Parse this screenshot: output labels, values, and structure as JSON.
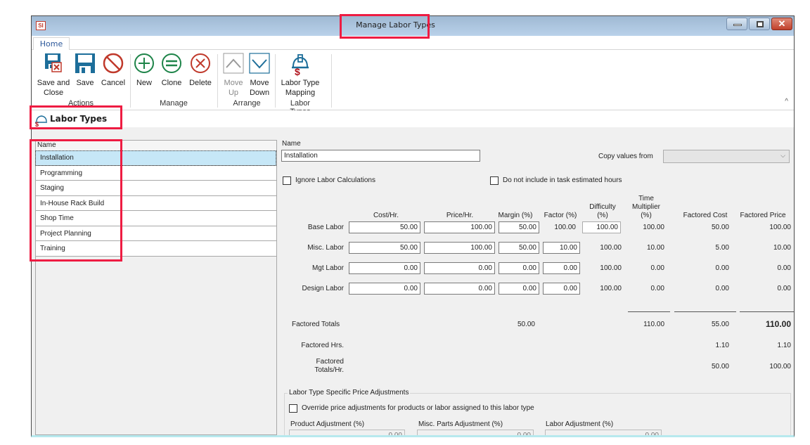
{
  "window": {
    "title": "Manage Labor Types",
    "app_icon": "SI",
    "controls": {
      "minimize": "minimize-icon",
      "maximize": "maximize-icon",
      "close": "close-icon"
    }
  },
  "ribbon": {
    "tabs": [
      {
        "label": "Home",
        "active": true
      }
    ],
    "groups": [
      {
        "label": "Actions",
        "buttons": [
          {
            "label_line1": "Save and",
            "label_line2": "Close",
            "icon": "save-close-icon",
            "enabled": true
          },
          {
            "label_line1": "Save",
            "label_line2": "",
            "icon": "save-icon",
            "enabled": true
          },
          {
            "label_line1": "Cancel",
            "label_line2": "",
            "icon": "cancel-icon",
            "enabled": true
          }
        ]
      },
      {
        "label": "Manage",
        "buttons": [
          {
            "label_line1": "New",
            "label_line2": "",
            "icon": "plus-circle-icon",
            "enabled": true
          },
          {
            "label_line1": "Clone",
            "label_line2": "",
            "icon": "equals-circle-icon",
            "enabled": true
          },
          {
            "label_line1": "Delete",
            "label_line2": "",
            "icon": "x-circle-icon",
            "enabled": true
          }
        ]
      },
      {
        "label": "Arrange",
        "buttons": [
          {
            "label_line1": "Move",
            "label_line2": "Up",
            "icon": "chevron-up-icon",
            "enabled": false
          },
          {
            "label_line1": "Move",
            "label_line2": "Down",
            "icon": "chevron-down-icon",
            "enabled": true
          }
        ]
      },
      {
        "label": "Labor Types",
        "buttons": [
          {
            "label_line1": "Labor Type",
            "label_line2": "Mapping",
            "icon": "hardhat-dollar-icon",
            "enabled": true
          }
        ]
      }
    ]
  },
  "section": {
    "title": "Labor Types",
    "icon": "hardhat-dollar-icon"
  },
  "list": {
    "header": "Name",
    "items": [
      "Installation",
      "Programming",
      "Staging",
      "In-House Rack Build",
      "Shop Time",
      "Project Planning",
      "Training"
    ],
    "selected_index": 0
  },
  "detail": {
    "name_label": "Name",
    "name_value": "Installation",
    "copy_from_label": "Copy values from",
    "copy_from_value": "",
    "ignore_calc_label": "Ignore Labor Calculations",
    "ignore_calc_checked": false,
    "exclude_hours_label": "Do not include in task estimated hours",
    "exclude_hours_checked": false,
    "columns": {
      "cost": "Cost/Hr.",
      "price": "Price/Hr.",
      "margin": "Margin (%)",
      "factor": "Factor (%)",
      "difficulty_1": "Difficulty",
      "difficulty_2": "(%)",
      "time_1": "Time",
      "time_2": "Multiplier",
      "time_3": "(%)",
      "factored_cost": "Factored Cost",
      "factored_price": "Factored Price"
    },
    "rows": [
      {
        "label": "Base Labor",
        "cost": "50.00",
        "price": "100.00",
        "margin": "50.00",
        "factor": "100.00",
        "difficulty": "100.00",
        "time_multiplier": "100.00",
        "factored_cost": "50.00",
        "factored_price": "100.00"
      },
      {
        "label": "Misc. Labor",
        "cost": "50.00",
        "price": "100.00",
        "margin": "50.00",
        "factor": "10.00",
        "difficulty": "100.00",
        "time_multiplier": "10.00",
        "factored_cost": "5.00",
        "factored_price": "10.00"
      },
      {
        "label": "Mgt Labor",
        "cost": "0.00",
        "price": "0.00",
        "margin": "0.00",
        "factor": "0.00",
        "difficulty": "100.00",
        "time_multiplier": "0.00",
        "factored_cost": "0.00",
        "factored_price": "0.00"
      },
      {
        "label": "Design Labor",
        "cost": "0.00",
        "price": "0.00",
        "margin": "0.00",
        "factor": "0.00",
        "difficulty": "100.00",
        "time_multiplier": "0.00",
        "factored_cost": "0.00",
        "factored_price": "0.00"
      }
    ],
    "totals": {
      "label": "Factored Totals",
      "margin": "50.00",
      "time_multiplier": "110.00",
      "factored_cost": "55.00",
      "factored_price": "110.00"
    },
    "hours": {
      "label": "Factored Hrs.",
      "factored_cost": "1.10",
      "factored_price": "1.10"
    },
    "per_hour": {
      "label_1": "Factored",
      "label_2": "Totals/Hr.",
      "factored_cost": "50.00",
      "factored_price": "100.00"
    },
    "adjustments": {
      "title": "Labor Type Specific Price Adjustments",
      "override_label": "Override price adjustments for products or labor assigned to this labor type",
      "override_checked": false,
      "product_label": "Product Adjustment (%)",
      "product_value": "0.00",
      "misc_label": "Misc. Parts Adjustment (%)",
      "misc_value": "0.00",
      "labor_label": "Labor Adjustment (%)",
      "labor_value": "0.00"
    }
  }
}
